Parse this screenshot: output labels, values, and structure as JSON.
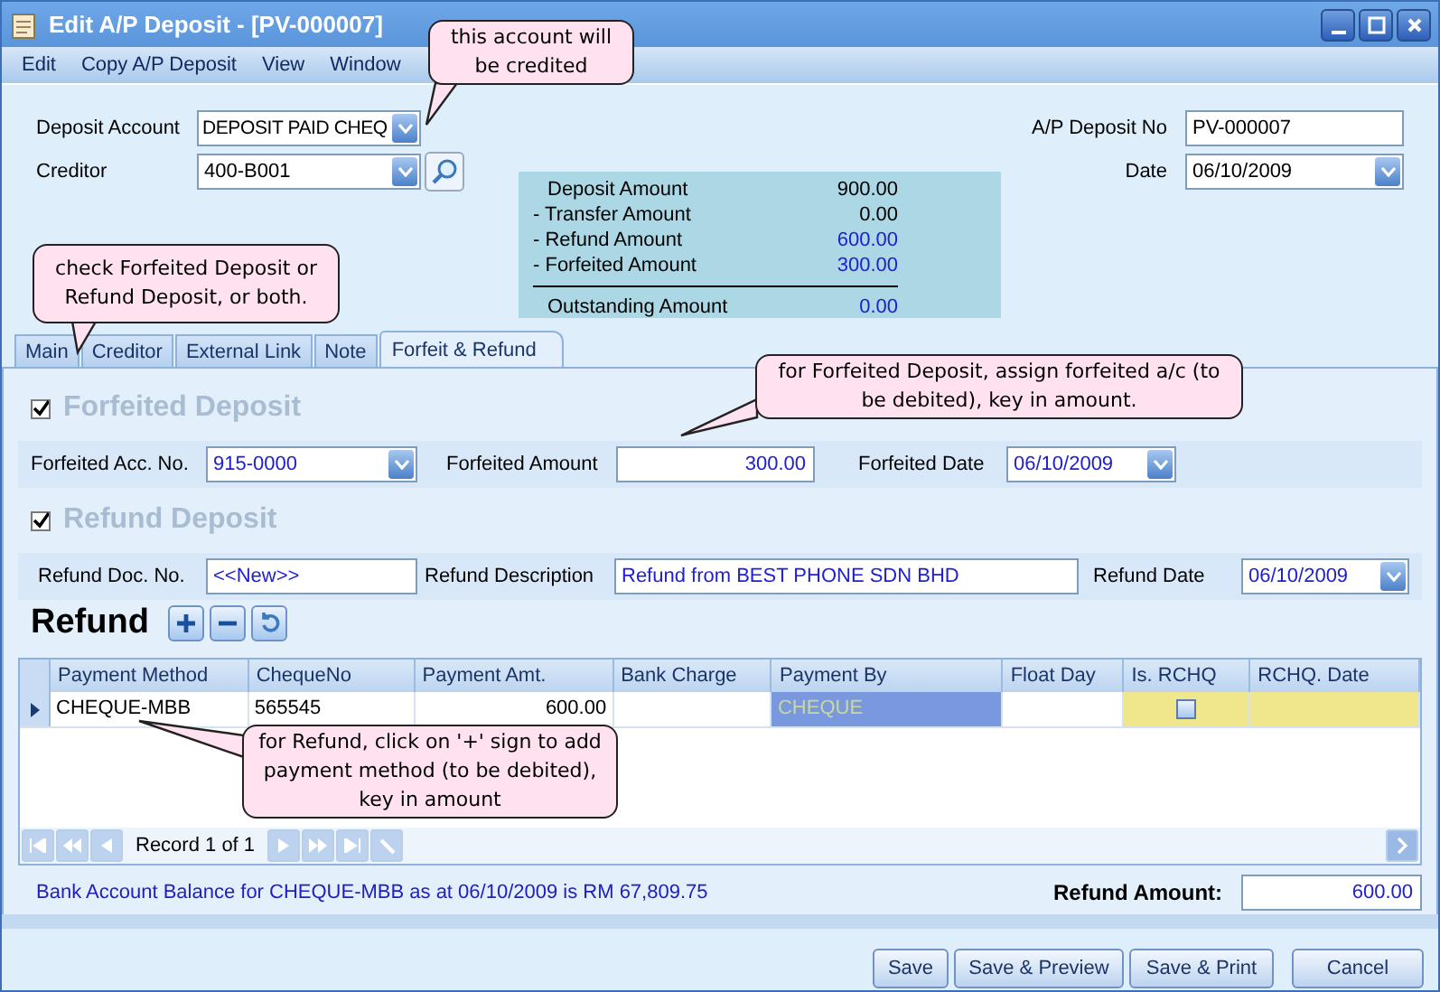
{
  "window": {
    "title": "Edit A/P Deposit - [PV-000007]"
  },
  "menu": [
    "Edit",
    "Copy A/P Deposit",
    "View",
    "Window"
  ],
  "header": {
    "deposit_account": {
      "label": "Deposit Account",
      "value": "DEPOSIT PAID CHEQ"
    },
    "creditor": {
      "label": "Creditor",
      "value": "400-B001"
    },
    "deposit_no": {
      "label": "A/P Deposit No",
      "value": "PV-000007"
    },
    "date": {
      "label": "Date",
      "value": "06/10/2009"
    }
  },
  "summary": {
    "rows": [
      {
        "label": "Deposit Amount",
        "value": "900.00",
        "color": "#000000"
      },
      {
        "label": "- Transfer Amount",
        "value": "0.00",
        "color": "#000000"
      },
      {
        "label": "- Refund Amount",
        "value": "600.00",
        "color": "#2020d0"
      },
      {
        "label": "- Forfeited Amount",
        "value": "300.00",
        "color": "#2020d0"
      }
    ],
    "total": {
      "label": "Outstanding Amount",
      "value": "0.00",
      "color": "#2020d0"
    }
  },
  "tabs": [
    {
      "label": "Main",
      "selected": false
    },
    {
      "label": "Creditor",
      "selected": false
    },
    {
      "label": "External Link",
      "selected": false
    },
    {
      "label": "Note",
      "selected": false
    },
    {
      "label": "Forfeit & Refund",
      "selected": true
    }
  ],
  "forfeit": {
    "title": "Forfeited Deposit",
    "checked": true,
    "account": {
      "label": "Forfeited Acc. No.",
      "value": "915-0000"
    },
    "amount": {
      "label": "Forfeited Amount",
      "value": "300.00"
    },
    "date": {
      "label": "Forfeited Date",
      "value": "06/10/2009"
    }
  },
  "refund": {
    "title": "Refund Deposit",
    "checked": true,
    "doc_no": {
      "label": "Refund Doc. No.",
      "value": "<<New>>"
    },
    "description": {
      "label": "Refund Description",
      "value": "Refund from BEST PHONE SDN BHD"
    },
    "date": {
      "label": "Refund Date",
      "value": "06/10/2009"
    },
    "heading": "Refund"
  },
  "table": {
    "columns": [
      {
        "label": "Payment Method",
        "kind": "text"
      },
      {
        "label": "ChequeNo",
        "kind": "text"
      },
      {
        "label": "Payment Amt.",
        "kind": "number"
      },
      {
        "label": "Bank Charge",
        "kind": "number"
      },
      {
        "label": "Payment By",
        "kind": "text"
      },
      {
        "label": "Float Day",
        "kind": "number"
      },
      {
        "label": "Is. RCHQ",
        "kind": "check"
      },
      {
        "label": "RCHQ. Date",
        "kind": "text"
      }
    ],
    "rows": [
      {
        "current": true,
        "cells": [
          {
            "value": "CHEQUE-MBB"
          },
          {
            "value": "565545"
          },
          {
            "value": "600.00"
          },
          {},
          {
            "value": "CHEQUE",
            "focused": true
          },
          {},
          {
            "checked": false,
            "highlighted": true
          },
          {
            "highlighted": true
          }
        ]
      }
    ],
    "navigator": "Record 1 of 1"
  },
  "footer": {
    "balance_note": "Bank Account Balance for CHEQUE-MBB as at 06/10/2009 is RM 67,809.75",
    "refund_amount": {
      "label": "Refund Amount:",
      "value": "600.00"
    }
  },
  "buttons": [
    "Save",
    "Save & Preview",
    "Save & Print",
    "Cancel"
  ],
  "callouts": [
    "this account will be credited",
    "check Forfeited Deposit or Refund Deposit, or both.",
    "for Forfeited Deposit, assign forfeited a/c (to be debited), key in amount.",
    "for Refund, click on '+' sign to add payment method (to be debited), key in amount"
  ]
}
